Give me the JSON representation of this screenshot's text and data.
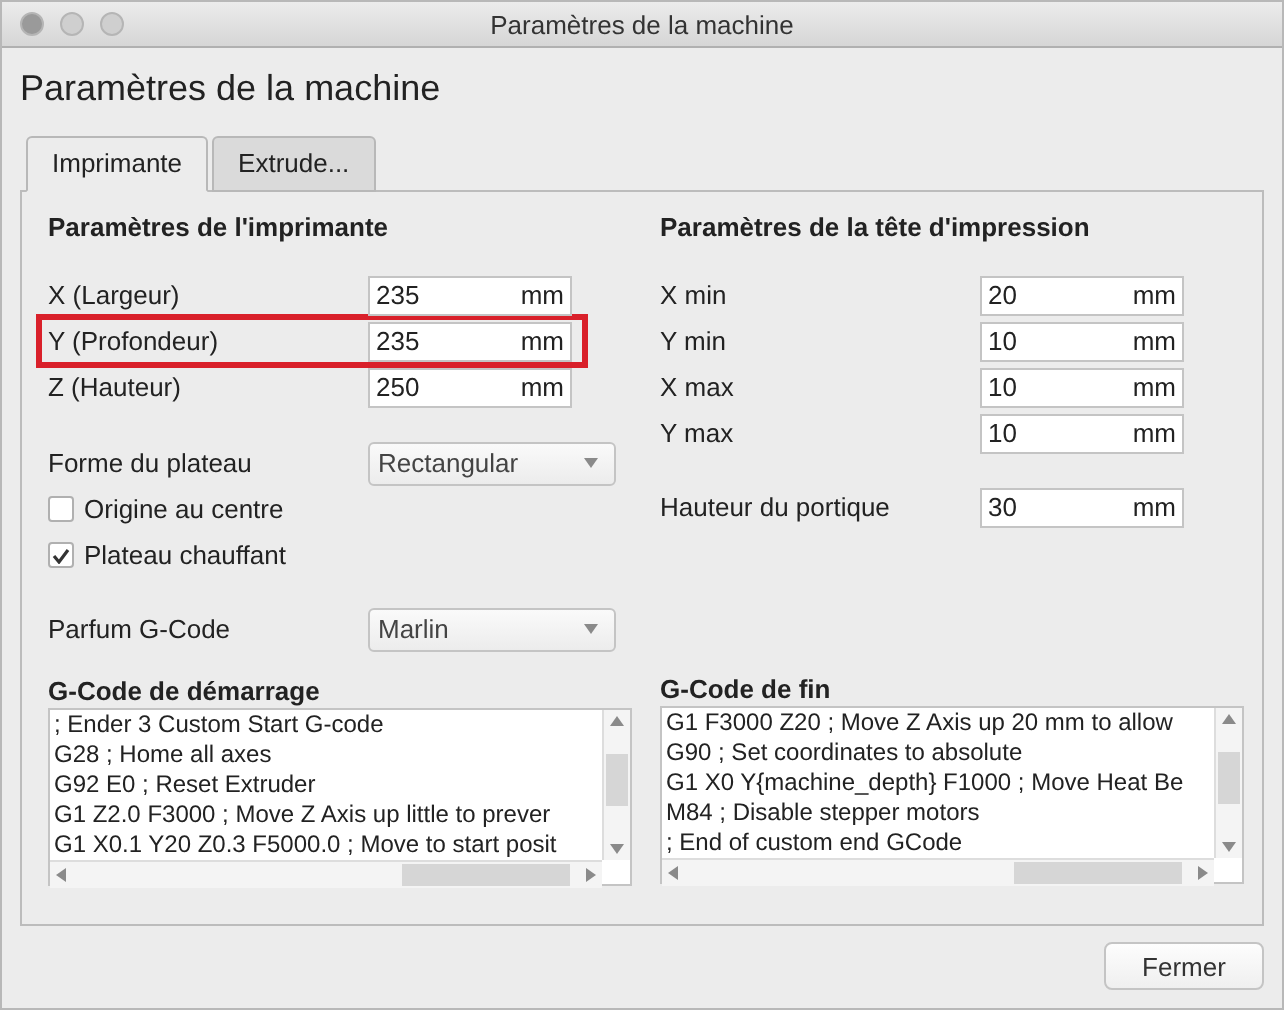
{
  "window": {
    "title": "Paramètres de la machine"
  },
  "heading": "Paramètres de la machine",
  "tabs": [
    {
      "label": "Imprimante",
      "selected": true
    },
    {
      "label": "Extrude...",
      "selected": false
    }
  ],
  "printer": {
    "title": "Paramètres de l'imprimante",
    "fields": [
      {
        "label": "X (Largeur)",
        "value": "235",
        "unit": "mm",
        "highlighted": false
      },
      {
        "label": "Y (Profondeur)",
        "value": "235",
        "unit": "mm",
        "highlighted": true
      },
      {
        "label": "Z (Hauteur)",
        "value": "250",
        "unit": "mm",
        "highlighted": false
      }
    ],
    "build_plate": {
      "label": "Forme du plateau",
      "value": "Rectangular"
    },
    "checkboxes": [
      {
        "label": "Origine au centre",
        "checked": false
      },
      {
        "label": "Plateau chauffant",
        "checked": true
      }
    ],
    "flavor": {
      "label": "Parfum G-Code",
      "value": "Marlin"
    }
  },
  "printhead": {
    "title": "Paramètres de la tête d'impression",
    "fields": [
      {
        "label": "X min",
        "value": "20",
        "unit": "mm"
      },
      {
        "label": "Y min",
        "value": "10",
        "unit": "mm"
      },
      {
        "label": "X max",
        "value": "10",
        "unit": "mm"
      },
      {
        "label": "Y max",
        "value": "10",
        "unit": "mm"
      }
    ],
    "gantry": {
      "label": "Hauteur du portique",
      "value": "30",
      "unit": "mm"
    }
  },
  "start_gcode": {
    "title": "G-Code de démarrage",
    "lines": [
      "; Ender 3 Custom Start G-code",
      "G28 ; Home all axes",
      "G92 E0 ; Reset Extruder",
      "G1 Z2.0 F3000 ; Move Z Axis up little to prever",
      "G1 X0.1 Y20 Z0.3 F5000.0 ; Move to start posit"
    ]
  },
  "end_gcode": {
    "title": "G-Code de fin",
    "lines": [
      "G1 F3000 Z20 ; Move Z Axis up 20 mm to allow",
      "G90 ; Set coordinates to absolute",
      "G1 X0 Y{machine_depth} F1000 ; Move Heat Be",
      "M84 ; Disable stepper motors",
      "; End of custom end GCode"
    ]
  },
  "buttons": [
    "Fermer"
  ]
}
